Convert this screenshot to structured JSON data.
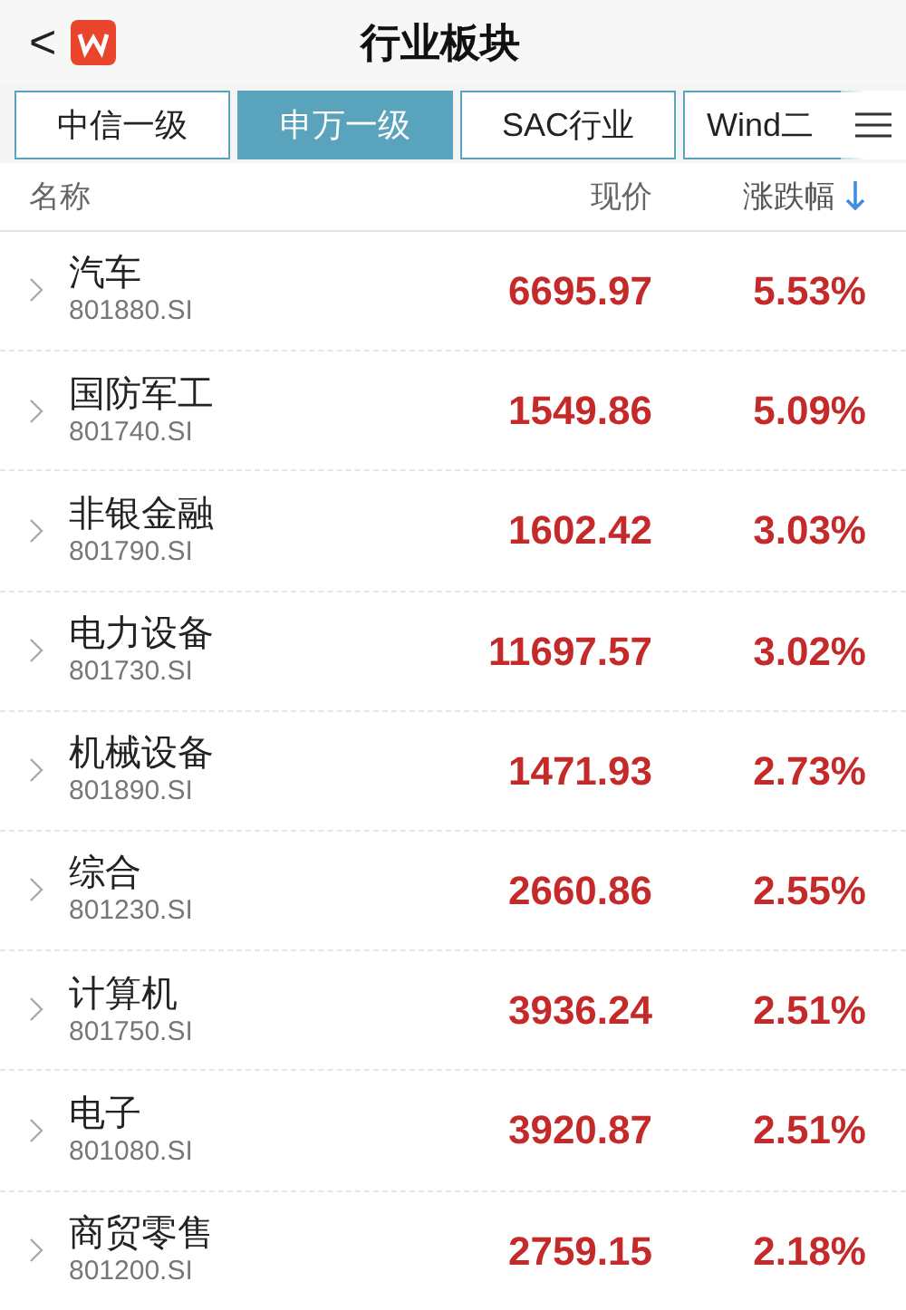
{
  "header": {
    "title": "行业板块",
    "back": "<"
  },
  "tabs": [
    {
      "label": "中信一级",
      "selected": false
    },
    {
      "label": "申万一级",
      "selected": true
    },
    {
      "label": "SAC行业",
      "selected": false
    },
    {
      "label": "Wind二",
      "selected": false
    }
  ],
  "table": {
    "columns": [
      {
        "label": "名称",
        "sorted": false
      },
      {
        "label": "现价",
        "sorted": false
      },
      {
        "label": "涨跌幅",
        "sorted": true
      }
    ],
    "rows": [
      {
        "name": "汽车",
        "code": "801880.SI",
        "price": "6695.97",
        "change": "5.53%"
      },
      {
        "name": "国防军工",
        "code": "801740.SI",
        "price": "1549.86",
        "change": "5.09%"
      },
      {
        "name": "非银金融",
        "code": "801790.SI",
        "price": "1602.42",
        "change": "3.03%"
      },
      {
        "name": "电力设备",
        "code": "801730.SI",
        "price": "11697.57",
        "change": "3.02%"
      },
      {
        "name": "机械设备",
        "code": "801890.SI",
        "price": "1471.93",
        "change": "2.73%"
      },
      {
        "name": "综合",
        "code": "801230.SI",
        "price": "2660.86",
        "change": "2.55%"
      },
      {
        "name": "计算机",
        "code": "801750.SI",
        "price": "3936.24",
        "change": "2.51%"
      },
      {
        "name": "电子",
        "code": "801080.SI",
        "price": "3920.87",
        "change": "2.51%"
      },
      {
        "name": "商贸零售",
        "code": "801200.SI",
        "price": "2759.15",
        "change": "2.18%"
      }
    ]
  }
}
